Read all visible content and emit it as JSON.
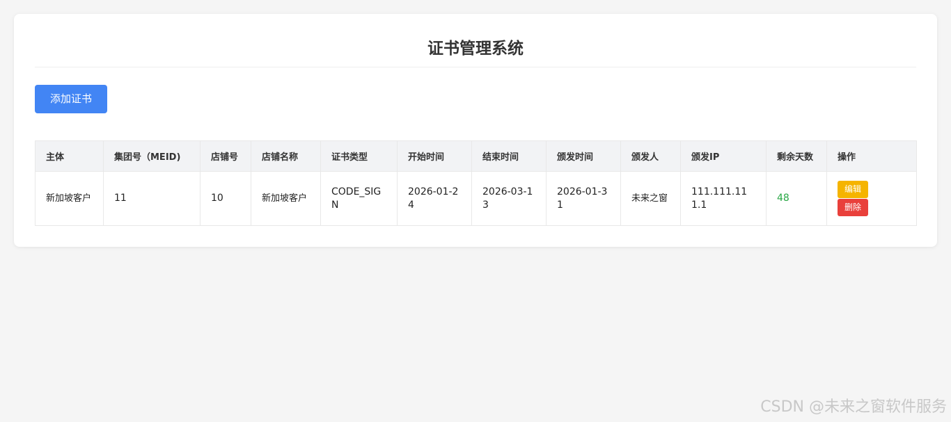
{
  "page": {
    "title": "证书管理系统"
  },
  "toolbar": {
    "add_label": "添加证书"
  },
  "table": {
    "headers": [
      "主体",
      "集团号（MEID)",
      "店铺号",
      "店铺名称",
      "证书类型",
      "开始时间",
      "结束时间",
      "颁发时间",
      "颁发人",
      "颁发IP",
      "剩余天数",
      "操作"
    ],
    "rows": [
      {
        "subject": "新加坡客户",
        "meid": "11",
        "store_no": "10",
        "store_name": "新加坡客户",
        "cert_type": "CODE_SIGN",
        "start": "2026-01-24",
        "end": "2026-03-13",
        "issued": "2026-01-31",
        "issuer": "未来之窗",
        "ip": "111.111.111.1",
        "days": "48",
        "edit_label": "编辑",
        "delete_label": "删除"
      }
    ]
  },
  "colors": {
    "primary": "#4285f4",
    "edit": "#f5b400",
    "delete": "#e9403b",
    "days": "#28a745"
  },
  "watermark": "CSDN @未来之窗软件服务"
}
